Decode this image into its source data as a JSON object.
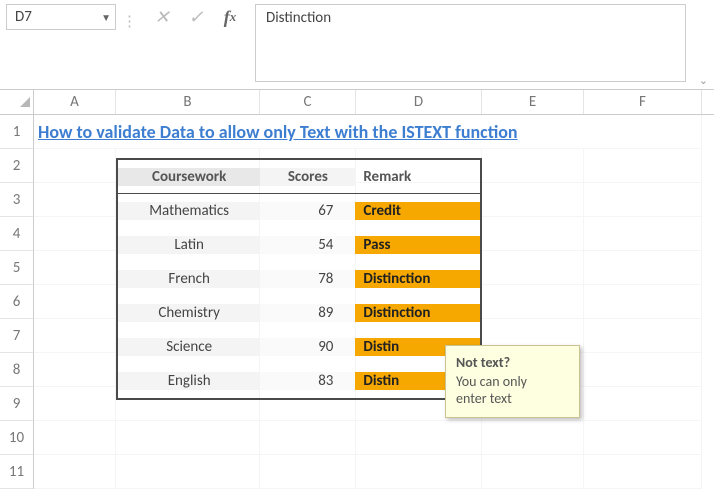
{
  "name_box": {
    "value": "D7"
  },
  "formula_input": {
    "value": "Distinction"
  },
  "columns": [
    "A",
    "B",
    "C",
    "D",
    "E",
    "F"
  ],
  "rows": [
    "1",
    "2",
    "3",
    "4",
    "5",
    "6",
    "7",
    "8",
    "9",
    "10",
    "11"
  ],
  "title": "How to validate Data to allow only Text with the ISTEXT function",
  "table": {
    "headers": {
      "coursework": "Coursework",
      "scores": "Scores",
      "remark": "Remark"
    },
    "rows": [
      {
        "coursework": "Mathematics",
        "score": "67",
        "remark": "Credit"
      },
      {
        "coursework": "Latin",
        "score": "54",
        "remark": "Pass"
      },
      {
        "coursework": "French",
        "score": "78",
        "remark": "Distinction"
      },
      {
        "coursework": "Chemistry",
        "score": "89",
        "remark": "Distinction"
      },
      {
        "coursework": "Science",
        "score": "90",
        "remark": "Distin"
      },
      {
        "coursework": "English",
        "score": "83",
        "remark": "Distin"
      }
    ]
  },
  "tooltip": {
    "title": "Not text?",
    "body1": "You can only",
    "body2": "enter text"
  }
}
